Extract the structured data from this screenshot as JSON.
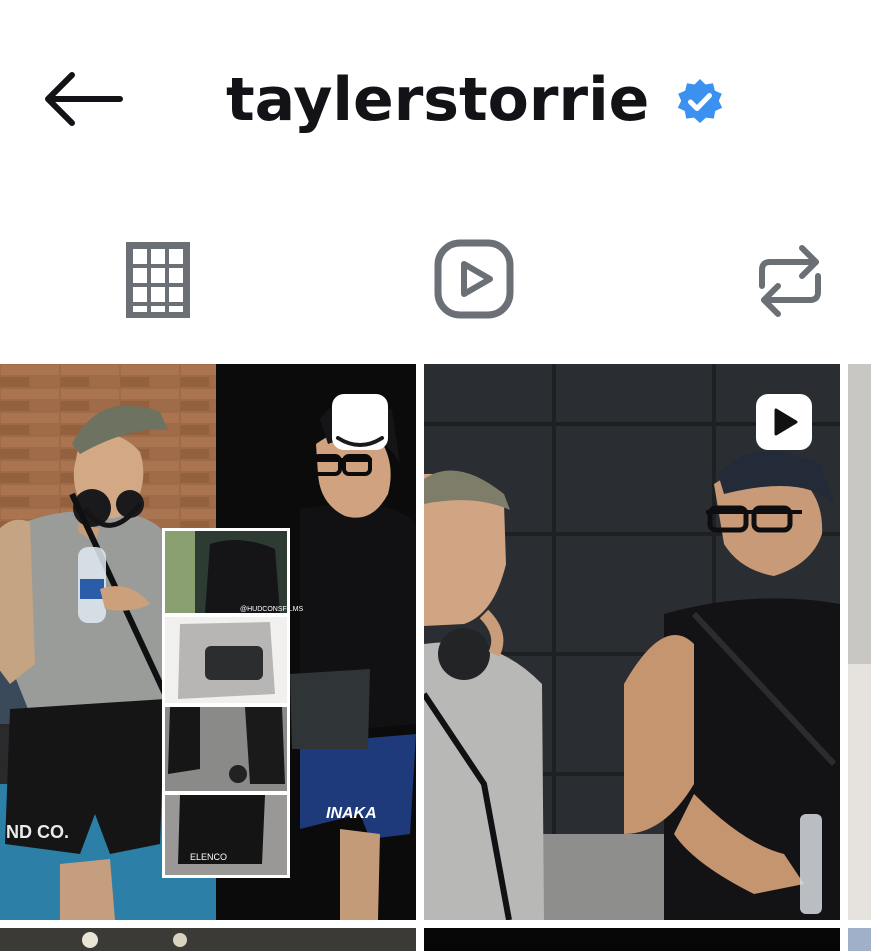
{
  "header": {
    "username": "taylerstorrie",
    "verified": true
  },
  "tabs": [
    {
      "name": "posts",
      "icon": "grid-icon",
      "selected": true
    },
    {
      "name": "reels",
      "icon": "reels-icon",
      "selected": false
    },
    {
      "name": "reposts",
      "icon": "repost-icon",
      "selected": false
    }
  ],
  "posts": [
    {
      "type": "carousel",
      "watermark": "@HUDCONSFILMS",
      "shirt_text_left": "ND CO.",
      "shorts_text_right": "INAKA",
      "shorts_text_inset": "ELENCO"
    },
    {
      "type": "reel"
    }
  ],
  "colors": {
    "text": "#121217",
    "icon": "#6b6f76",
    "verified": "#3b91f0"
  }
}
